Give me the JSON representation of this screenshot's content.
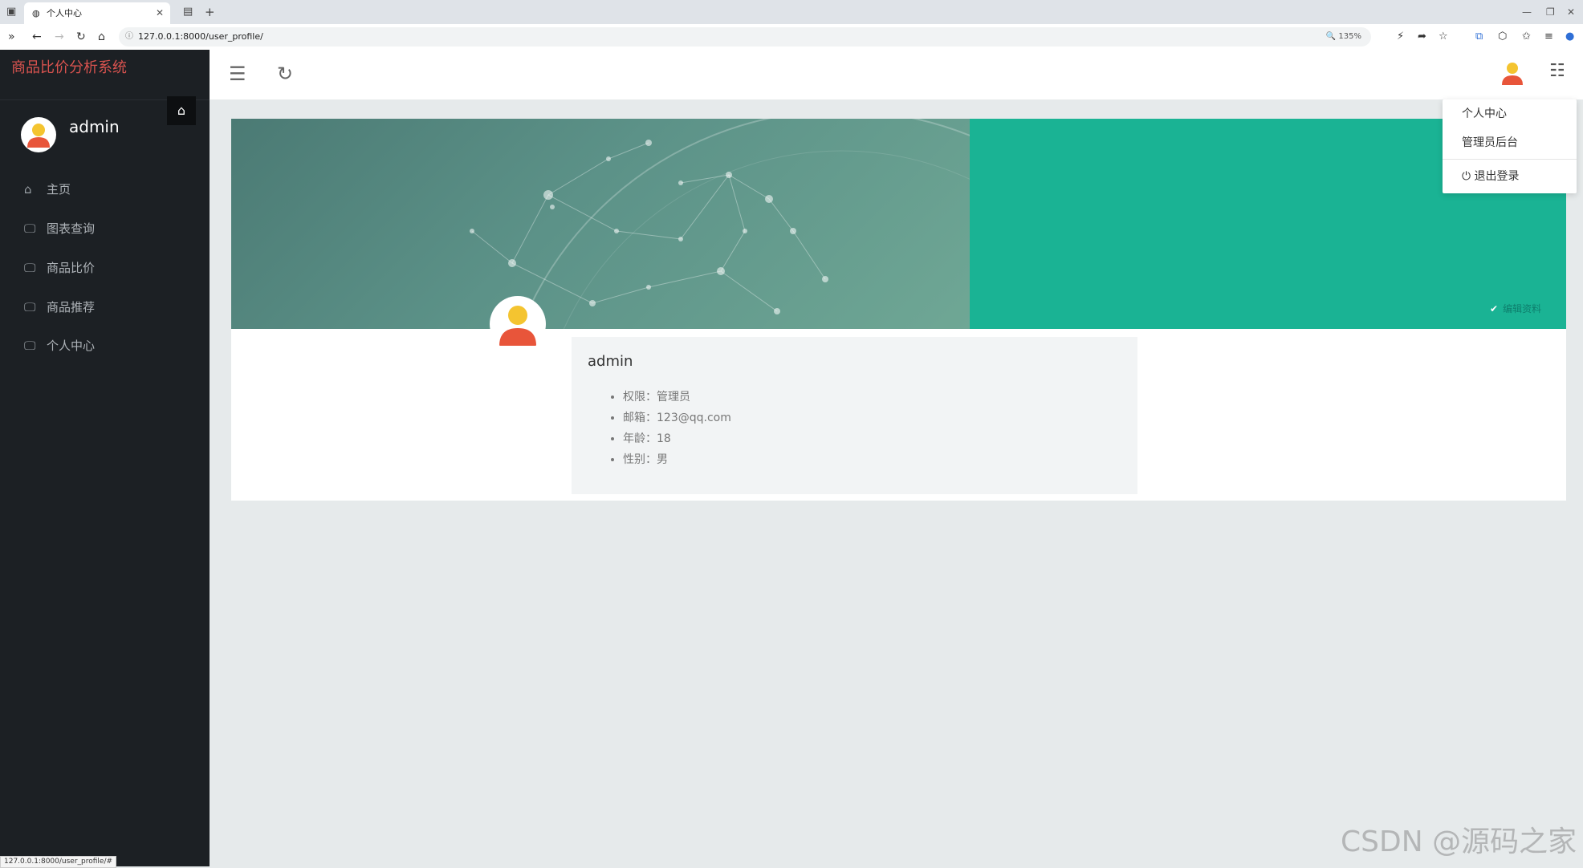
{
  "browser": {
    "tab_title": "个人中心",
    "url": "127.0.0.1:8000/user_profile/",
    "zoom": "135%",
    "status_url": "127.0.0.1:8000/user_profile/#"
  },
  "sidebar": {
    "brand": "商品比价分析系统",
    "username": "admin",
    "items": [
      {
        "label": "主页",
        "icon": "home-icon"
      },
      {
        "label": "图表查询",
        "icon": "monitor-icon"
      },
      {
        "label": "商品比价",
        "icon": "monitor-icon"
      },
      {
        "label": "商品推荐",
        "icon": "monitor-icon"
      },
      {
        "label": "个人中心",
        "icon": "monitor-icon"
      }
    ]
  },
  "dropdown": {
    "items": [
      "个人中心",
      "管理员后台"
    ],
    "logout": "退出登录"
  },
  "profile": {
    "edit_label": "编辑资料",
    "name": "admin",
    "fields": [
      "权限：管理员",
      "邮箱：123@qq.com",
      "年龄：18",
      "性别：男"
    ]
  },
  "watermark": "CSDN @源码之家",
  "colors": {
    "sidebar_bg": "#1c2024",
    "brand": "#d9534f",
    "banner_accent": "#1ab394",
    "avatar_body": "#e8553a",
    "avatar_head": "#f4c430"
  }
}
